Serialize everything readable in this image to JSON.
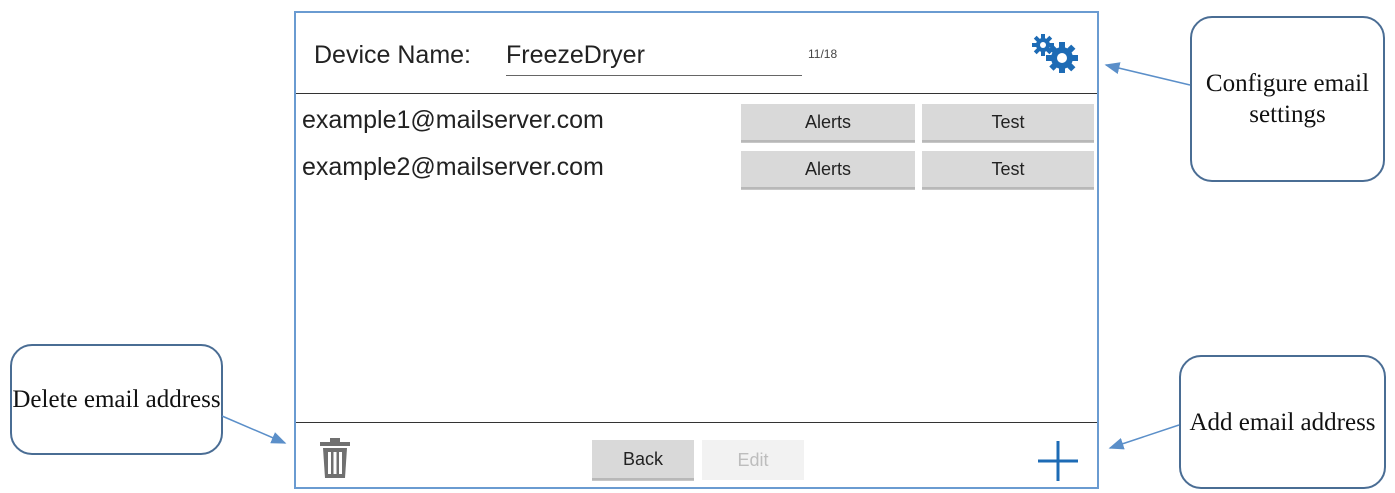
{
  "header": {
    "device_name_label": "Device Name:",
    "device_name_value": "FreezeDryer",
    "char_counter": "11/18",
    "settings_icon": "gears-icon"
  },
  "emails": [
    {
      "address": "example1@mailserver.com",
      "alerts_label": "Alerts",
      "test_label": "Test"
    },
    {
      "address": "example2@mailserver.com",
      "alerts_label": "Alerts",
      "test_label": "Test"
    }
  ],
  "footer": {
    "delete_icon": "trash-icon",
    "back_label": "Back",
    "edit_label": "Edit",
    "add_icon": "plus-icon"
  },
  "callouts": {
    "configure": "Configure email settings",
    "delete": "Delete email address",
    "add": "Add email address"
  },
  "colors": {
    "accent_blue": "#1d6bb5",
    "frame_border": "#6a9bd1",
    "button_gray": "#d9d9d9",
    "callout_border": "#4a6d94"
  }
}
